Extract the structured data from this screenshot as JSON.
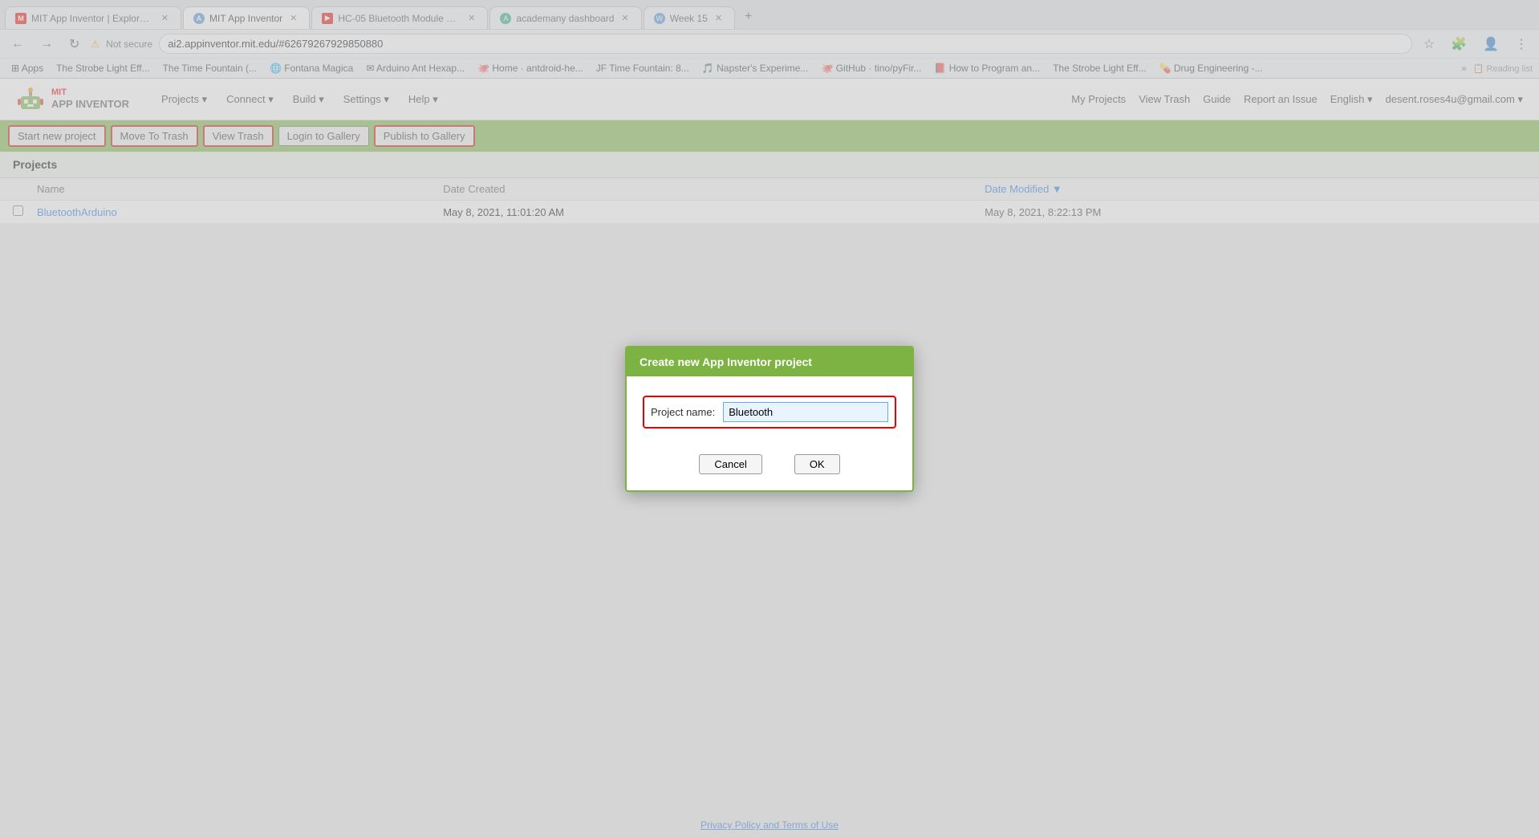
{
  "browser": {
    "tabs": [
      {
        "id": "tab1",
        "favicon_color": "#e00",
        "title": "MIT App Inventor | Explore MIT",
        "active": false,
        "closable": true
      },
      {
        "id": "tab2",
        "favicon_color": "#4a90d9",
        "title": "MIT App Inventor",
        "active": true,
        "closable": true
      },
      {
        "id": "tab3",
        "favicon_color": "#e00",
        "title": "HC-05 Bluetooth Module with A...",
        "active": false,
        "closable": true
      },
      {
        "id": "tab4",
        "favicon_color": "#2a7",
        "title": "academany dashboard",
        "active": false,
        "closable": true
      },
      {
        "id": "tab5",
        "favicon_color": "#4a90d9",
        "title": "Week 15",
        "active": false,
        "closable": true
      }
    ],
    "address": "ai2.appinventor.mit.edu/#62679267929850880",
    "lock_label": "Not secure"
  },
  "bookmarks": [
    {
      "label": "Apps"
    },
    {
      "label": "The Strobe Light Eff..."
    },
    {
      "label": "The Time Fountain (..."
    },
    {
      "label": "Fontana Magica"
    },
    {
      "label": "Arduino Ant Hexap..."
    },
    {
      "label": "Home · antdroid-he..."
    },
    {
      "label": "JF Time Fountain: 8..."
    },
    {
      "label": "Napster's Experime..."
    },
    {
      "label": "GitHub · tino/pyFir..."
    },
    {
      "label": "How to Program an..."
    },
    {
      "label": "The Strobe Light Eff..."
    },
    {
      "label": "Drug Engineering -..."
    }
  ],
  "header": {
    "logo_mit": "MIT",
    "logo_app_inventor": "APP INVENTOR",
    "nav_items": [
      {
        "label": "Projects ▾"
      },
      {
        "label": "Connect ▾"
      },
      {
        "label": "Build ▾"
      },
      {
        "label": "Settings ▾"
      },
      {
        "label": "Help ▾"
      }
    ],
    "right_links": [
      {
        "label": "My Projects"
      },
      {
        "label": "View Trash"
      },
      {
        "label": "Guide"
      },
      {
        "label": "Report an Issue"
      },
      {
        "label": "English ▾"
      },
      {
        "label": "desent.roses4u@gmail.com ▾"
      }
    ]
  },
  "toolbar": {
    "start_new_project": "Start new project",
    "move_to_trash": "Move To Trash",
    "view_trash": "View Trash",
    "login_to_gallery": "Login to Gallery",
    "publish_to_gallery": "Publish to Gallery"
  },
  "projects_section": {
    "title": "Projects",
    "columns": {
      "name": "Name",
      "date_created": "Date Created",
      "date_modified": "Date Modified ▼"
    },
    "rows": [
      {
        "name": "BluetoothArduino",
        "date_created": "May 8, 2021, 11:01:20 AM",
        "date_modified": "May 8, 2021, 8:22:13 PM"
      }
    ]
  },
  "modal": {
    "title": "Create new App Inventor project",
    "field_label": "Project name:",
    "field_value": "Bluetooth",
    "cancel_label": "Cancel",
    "ok_label": "OK"
  },
  "footer": {
    "link_text": "Privacy Policy and Terms of Use"
  }
}
